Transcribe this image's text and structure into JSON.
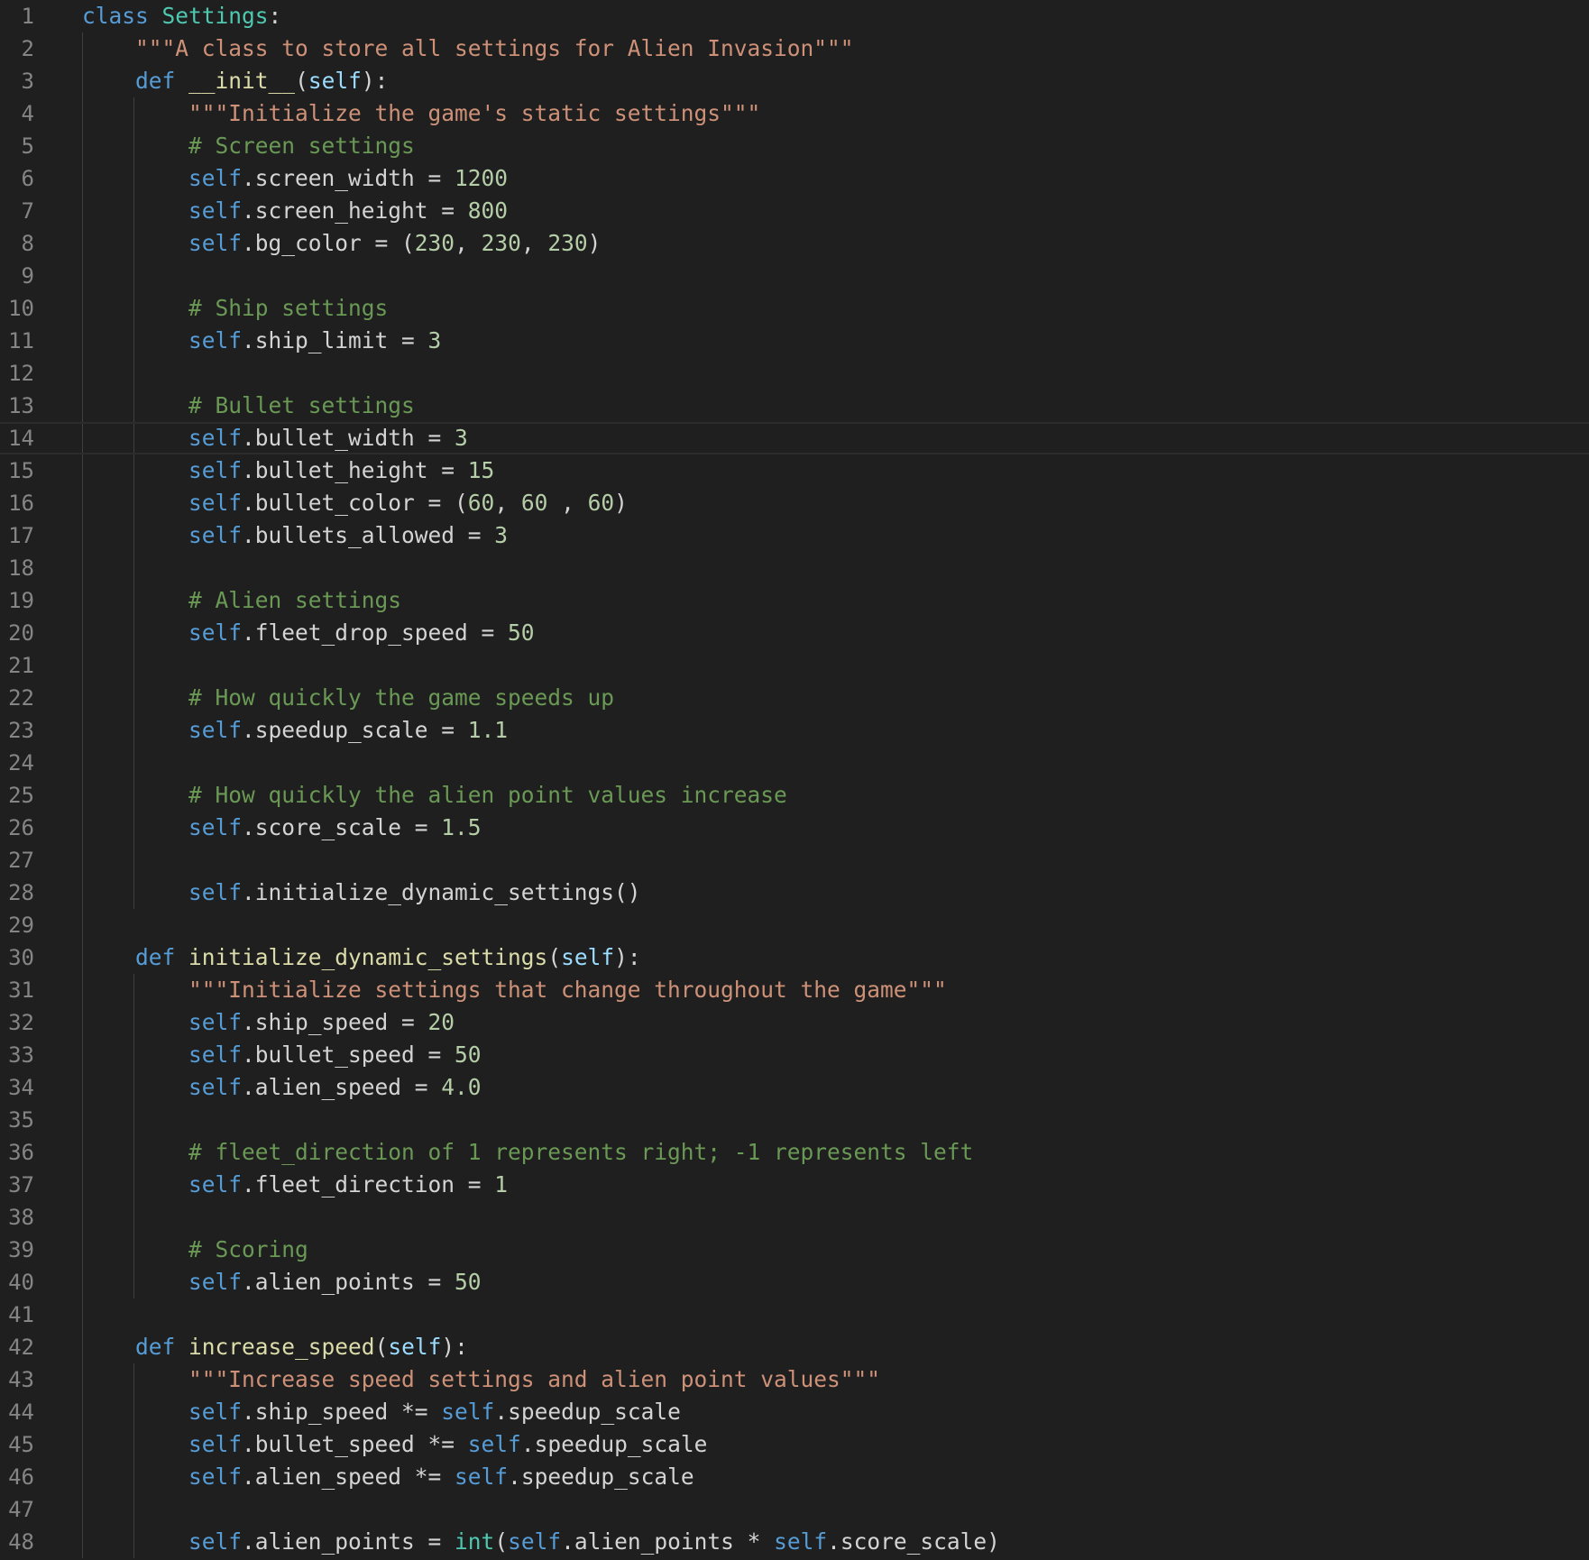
{
  "editor": {
    "language": "python",
    "current_line": 14,
    "colors": {
      "background": "#1f1f1f",
      "line_number": "#858585",
      "keyword": "#569cd6",
      "class_name": "#4ec9b0",
      "function_name": "#dcdcaa",
      "string": "#ce9178",
      "comment": "#6a9955",
      "number": "#b5cea8",
      "plain": "#d4d4d4"
    },
    "lines": [
      {
        "n": "1",
        "tokens": [
          [
            "kw",
            "class"
          ],
          [
            "plain",
            " "
          ],
          [
            "cls",
            "Settings"
          ],
          [
            "plain",
            ":"
          ]
        ]
      },
      {
        "n": "2",
        "tokens": [
          [
            "plain",
            "    "
          ],
          [
            "str",
            "\"\"\"A class to store all settings for Alien Invasion\"\"\""
          ]
        ]
      },
      {
        "n": "3",
        "tokens": [
          [
            "plain",
            "    "
          ],
          [
            "kw",
            "def"
          ],
          [
            "plain",
            " "
          ],
          [
            "fn",
            "__init__"
          ],
          [
            "plain",
            "("
          ],
          [
            "selfp",
            "self"
          ],
          [
            "plain",
            "):"
          ]
        ]
      },
      {
        "n": "4",
        "tokens": [
          [
            "plain",
            "        "
          ],
          [
            "str",
            "\"\"\"Initialize the game's static settings\"\"\""
          ]
        ]
      },
      {
        "n": "5",
        "tokens": [
          [
            "plain",
            "        "
          ],
          [
            "com",
            "# Screen settings"
          ]
        ]
      },
      {
        "n": "6",
        "tokens": [
          [
            "plain",
            "        "
          ],
          [
            "self",
            "self"
          ],
          [
            "plain",
            ".screen_width = "
          ],
          [
            "num",
            "1200"
          ]
        ]
      },
      {
        "n": "7",
        "tokens": [
          [
            "plain",
            "        "
          ],
          [
            "self",
            "self"
          ],
          [
            "plain",
            ".screen_height = "
          ],
          [
            "num",
            "800"
          ]
        ]
      },
      {
        "n": "8",
        "tokens": [
          [
            "plain",
            "        "
          ],
          [
            "self",
            "self"
          ],
          [
            "plain",
            ".bg_color = ("
          ],
          [
            "num",
            "230"
          ],
          [
            "plain",
            ", "
          ],
          [
            "num",
            "230"
          ],
          [
            "plain",
            ", "
          ],
          [
            "num",
            "230"
          ],
          [
            "plain",
            ")"
          ]
        ]
      },
      {
        "n": "9",
        "tokens": []
      },
      {
        "n": "10",
        "tokens": [
          [
            "plain",
            "        "
          ],
          [
            "com",
            "# Ship settings"
          ]
        ]
      },
      {
        "n": "11",
        "tokens": [
          [
            "plain",
            "        "
          ],
          [
            "self",
            "self"
          ],
          [
            "plain",
            ".ship_limit = "
          ],
          [
            "num",
            "3"
          ]
        ]
      },
      {
        "n": "12",
        "tokens": []
      },
      {
        "n": "13",
        "tokens": [
          [
            "plain",
            "        "
          ],
          [
            "com",
            "# Bullet settings"
          ]
        ]
      },
      {
        "n": "14",
        "tokens": [
          [
            "plain",
            "        "
          ],
          [
            "self",
            "self"
          ],
          [
            "plain",
            ".bullet_width = "
          ],
          [
            "num",
            "3"
          ]
        ]
      },
      {
        "n": "15",
        "tokens": [
          [
            "plain",
            "        "
          ],
          [
            "self",
            "self"
          ],
          [
            "plain",
            ".bullet_height = "
          ],
          [
            "num",
            "15"
          ]
        ]
      },
      {
        "n": "16",
        "tokens": [
          [
            "plain",
            "        "
          ],
          [
            "self",
            "self"
          ],
          [
            "plain",
            ".bullet_color = ("
          ],
          [
            "num",
            "60"
          ],
          [
            "plain",
            ", "
          ],
          [
            "num",
            "60"
          ],
          [
            "plain",
            " , "
          ],
          [
            "num",
            "60"
          ],
          [
            "plain",
            ")"
          ]
        ]
      },
      {
        "n": "17",
        "tokens": [
          [
            "plain",
            "        "
          ],
          [
            "self",
            "self"
          ],
          [
            "plain",
            ".bullets_allowed = "
          ],
          [
            "num",
            "3"
          ]
        ]
      },
      {
        "n": "18",
        "tokens": []
      },
      {
        "n": "19",
        "tokens": [
          [
            "plain",
            "        "
          ],
          [
            "com",
            "# Alien settings"
          ]
        ]
      },
      {
        "n": "20",
        "tokens": [
          [
            "plain",
            "        "
          ],
          [
            "self",
            "self"
          ],
          [
            "plain",
            ".fleet_drop_speed = "
          ],
          [
            "num",
            "50"
          ]
        ]
      },
      {
        "n": "21",
        "tokens": []
      },
      {
        "n": "22",
        "tokens": [
          [
            "plain",
            "        "
          ],
          [
            "com",
            "# How quickly the game speeds up"
          ]
        ]
      },
      {
        "n": "23",
        "tokens": [
          [
            "plain",
            "        "
          ],
          [
            "self",
            "self"
          ],
          [
            "plain",
            ".speedup_scale = "
          ],
          [
            "num",
            "1.1"
          ]
        ]
      },
      {
        "n": "24",
        "tokens": []
      },
      {
        "n": "25",
        "tokens": [
          [
            "plain",
            "        "
          ],
          [
            "com",
            "# How quickly the alien point values increase"
          ]
        ]
      },
      {
        "n": "26",
        "tokens": [
          [
            "plain",
            "        "
          ],
          [
            "self",
            "self"
          ],
          [
            "plain",
            ".score_scale = "
          ],
          [
            "num",
            "1.5"
          ]
        ]
      },
      {
        "n": "27",
        "tokens": []
      },
      {
        "n": "28",
        "tokens": [
          [
            "plain",
            "        "
          ],
          [
            "self",
            "self"
          ],
          [
            "plain",
            ".initialize_dynamic_settings()"
          ]
        ]
      },
      {
        "n": "29",
        "tokens": []
      },
      {
        "n": "30",
        "tokens": [
          [
            "plain",
            "    "
          ],
          [
            "kw",
            "def"
          ],
          [
            "plain",
            " "
          ],
          [
            "fn",
            "initialize_dynamic_settings"
          ],
          [
            "plain",
            "("
          ],
          [
            "selfp",
            "self"
          ],
          [
            "plain",
            "):"
          ]
        ]
      },
      {
        "n": "31",
        "tokens": [
          [
            "plain",
            "        "
          ],
          [
            "str",
            "\"\"\"Initialize settings that change throughout the game\"\"\""
          ]
        ]
      },
      {
        "n": "32",
        "tokens": [
          [
            "plain",
            "        "
          ],
          [
            "self",
            "self"
          ],
          [
            "plain",
            ".ship_speed = "
          ],
          [
            "num",
            "20"
          ]
        ]
      },
      {
        "n": "33",
        "tokens": [
          [
            "plain",
            "        "
          ],
          [
            "self",
            "self"
          ],
          [
            "plain",
            ".bullet_speed = "
          ],
          [
            "num",
            "50"
          ]
        ]
      },
      {
        "n": "34",
        "tokens": [
          [
            "plain",
            "        "
          ],
          [
            "self",
            "self"
          ],
          [
            "plain",
            ".alien_speed = "
          ],
          [
            "num",
            "4.0"
          ]
        ]
      },
      {
        "n": "35",
        "tokens": []
      },
      {
        "n": "36",
        "tokens": [
          [
            "plain",
            "        "
          ],
          [
            "com",
            "# fleet_direction of 1 represents right; -1 represents left"
          ]
        ]
      },
      {
        "n": "37",
        "tokens": [
          [
            "plain",
            "        "
          ],
          [
            "self",
            "self"
          ],
          [
            "plain",
            ".fleet_direction = "
          ],
          [
            "num",
            "1"
          ]
        ]
      },
      {
        "n": "38",
        "tokens": []
      },
      {
        "n": "39",
        "tokens": [
          [
            "plain",
            "        "
          ],
          [
            "com",
            "# Scoring"
          ]
        ]
      },
      {
        "n": "40",
        "tokens": [
          [
            "plain",
            "        "
          ],
          [
            "self",
            "self"
          ],
          [
            "plain",
            ".alien_points = "
          ],
          [
            "num",
            "50"
          ]
        ]
      },
      {
        "n": "41",
        "tokens": []
      },
      {
        "n": "42",
        "tokens": [
          [
            "plain",
            "    "
          ],
          [
            "kw",
            "def"
          ],
          [
            "plain",
            " "
          ],
          [
            "fn",
            "increase_speed"
          ],
          [
            "plain",
            "("
          ],
          [
            "selfp",
            "self"
          ],
          [
            "plain",
            "):"
          ]
        ]
      },
      {
        "n": "43",
        "tokens": [
          [
            "plain",
            "        "
          ],
          [
            "str",
            "\"\"\"Increase speed settings and alien point values\"\"\""
          ]
        ]
      },
      {
        "n": "44",
        "tokens": [
          [
            "plain",
            "        "
          ],
          [
            "self",
            "self"
          ],
          [
            "plain",
            ".ship_speed *= "
          ],
          [
            "self",
            "self"
          ],
          [
            "plain",
            ".speedup_scale"
          ]
        ]
      },
      {
        "n": "45",
        "tokens": [
          [
            "plain",
            "        "
          ],
          [
            "self",
            "self"
          ],
          [
            "plain",
            ".bullet_speed *= "
          ],
          [
            "self",
            "self"
          ],
          [
            "plain",
            ".speedup_scale"
          ]
        ]
      },
      {
        "n": "46",
        "tokens": [
          [
            "plain",
            "        "
          ],
          [
            "self",
            "self"
          ],
          [
            "plain",
            ".alien_speed *= "
          ],
          [
            "self",
            "self"
          ],
          [
            "plain",
            ".speedup_scale"
          ]
        ]
      },
      {
        "n": "47",
        "tokens": []
      },
      {
        "n": "48",
        "tokens": [
          [
            "plain",
            "        "
          ],
          [
            "self",
            "self"
          ],
          [
            "plain",
            ".alien_points = "
          ],
          [
            "bi",
            "int"
          ],
          [
            "plain",
            "("
          ],
          [
            "self",
            "self"
          ],
          [
            "plain",
            ".alien_points * "
          ],
          [
            "self",
            "self"
          ],
          [
            "plain",
            ".score_scale)"
          ]
        ]
      }
    ]
  }
}
